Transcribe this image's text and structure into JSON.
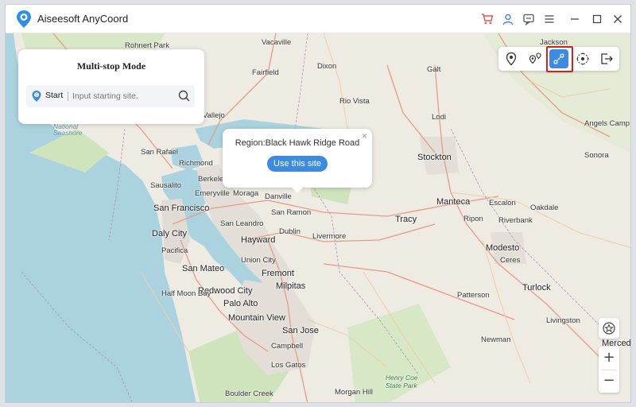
{
  "app": {
    "title": "Aiseesoft AnyCoord"
  },
  "titlebar_icons": [
    "cart-icon",
    "user-icon",
    "feedback-icon",
    "menu-icon",
    "minimize-icon",
    "maximize-icon",
    "close-icon"
  ],
  "panel": {
    "title": "Multi-stop Mode",
    "start_label": "Start",
    "start_placeholder": "Input starting site."
  },
  "popup": {
    "region_text": "Region:Black Hawk Ridge Road",
    "close": "×",
    "button": "Use this site"
  },
  "mode_bar": {
    "buttons": [
      "teleport-mode-icon",
      "one-stop-mode-icon",
      "multi-stop-mode-icon",
      "joystick-mode-icon",
      "exit-icon"
    ],
    "active": "multi-stop-mode-icon",
    "highlight_color": "#d9211c"
  },
  "zoom": {
    "in": "+",
    "out": "−"
  },
  "map_labels": {
    "vacaville": "Vacaville",
    "fairfield": "Fairfield",
    "rohnert": "Rohnert Park",
    "vallejo": "Vallejo",
    "seashore": "Seashore",
    "national": "National",
    "san_rafael": "San Rafael",
    "richmond": "Richmond",
    "berkeley": "Berkele",
    "sausalito": "Sausalito",
    "emeryville": "Emeryville",
    "moraga": "Moraga",
    "danville": "Danville",
    "san_francisco": "San Francisco",
    "san_leandro": "San Leandro",
    "san_ramon": "San Ramon",
    "daly_city": "Daly City",
    "hayward": "Hayward",
    "dublin": "Dublin",
    "livermore": "Livermore",
    "pacifica": "Pacifica",
    "san_mateo": "San Mateo",
    "union_city": "Union City",
    "fremont": "Fremont",
    "redwood_city": "Redwood City",
    "half_moon_bay": "Half Moon Bay",
    "palo_alto": "Palo Alto",
    "milpitas": "Milpitas",
    "mountain_view": "Mountain View",
    "san_jose": "San Jose",
    "campbell": "Campbell",
    "los_gatos": "Los Gatos",
    "boulder_creek": "Boulder Creek",
    "morgan_hill": "Morgan Hill",
    "henry_coe": "Henry Coe State Park",
    "dixon": "Dixon",
    "rio_vista": "Rio Vista",
    "galt": "Galt",
    "lodi": "Lodi",
    "jackson": "Jackson",
    "stockton": "Stockton",
    "angels_camp": "Angels Camp",
    "manteca": "Manteca",
    "escalon": "Escalon",
    "tracy": "Tracy",
    "ripon": "Ripon",
    "riverbank": "Riverbank",
    "oakdale": "Oakdale",
    "modesto": "Modesto",
    "ceres": "Ceres",
    "turlock": "Turlock",
    "patterson": "Patterson",
    "livingston": "Livingston",
    "newman": "Newman",
    "merced": "Merced",
    "sonora": "Sonora"
  }
}
